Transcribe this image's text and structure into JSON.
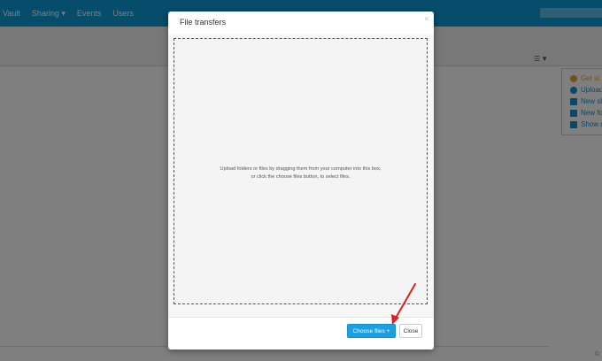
{
  "app": {
    "nav": [
      "Vault",
      "Sharing ▾",
      "Events",
      "Users"
    ]
  },
  "sidepanel": {
    "items": [
      "Get st",
      "Upload",
      "New sh",
      "New fo",
      "Show d"
    ]
  },
  "modal": {
    "title": "File transfers",
    "close_glyph": "×",
    "drop_line1": "Upload folders or files by dragging them from your computer into this box,",
    "drop_line2": "or click the choose files button, to select files.",
    "choose_label": "Choose files +",
    "close_label": "Close"
  },
  "colors": {
    "topbar": "#0a9bd4",
    "primary_button": "#1ba1e2",
    "annotation_arrow": "#e02020"
  }
}
